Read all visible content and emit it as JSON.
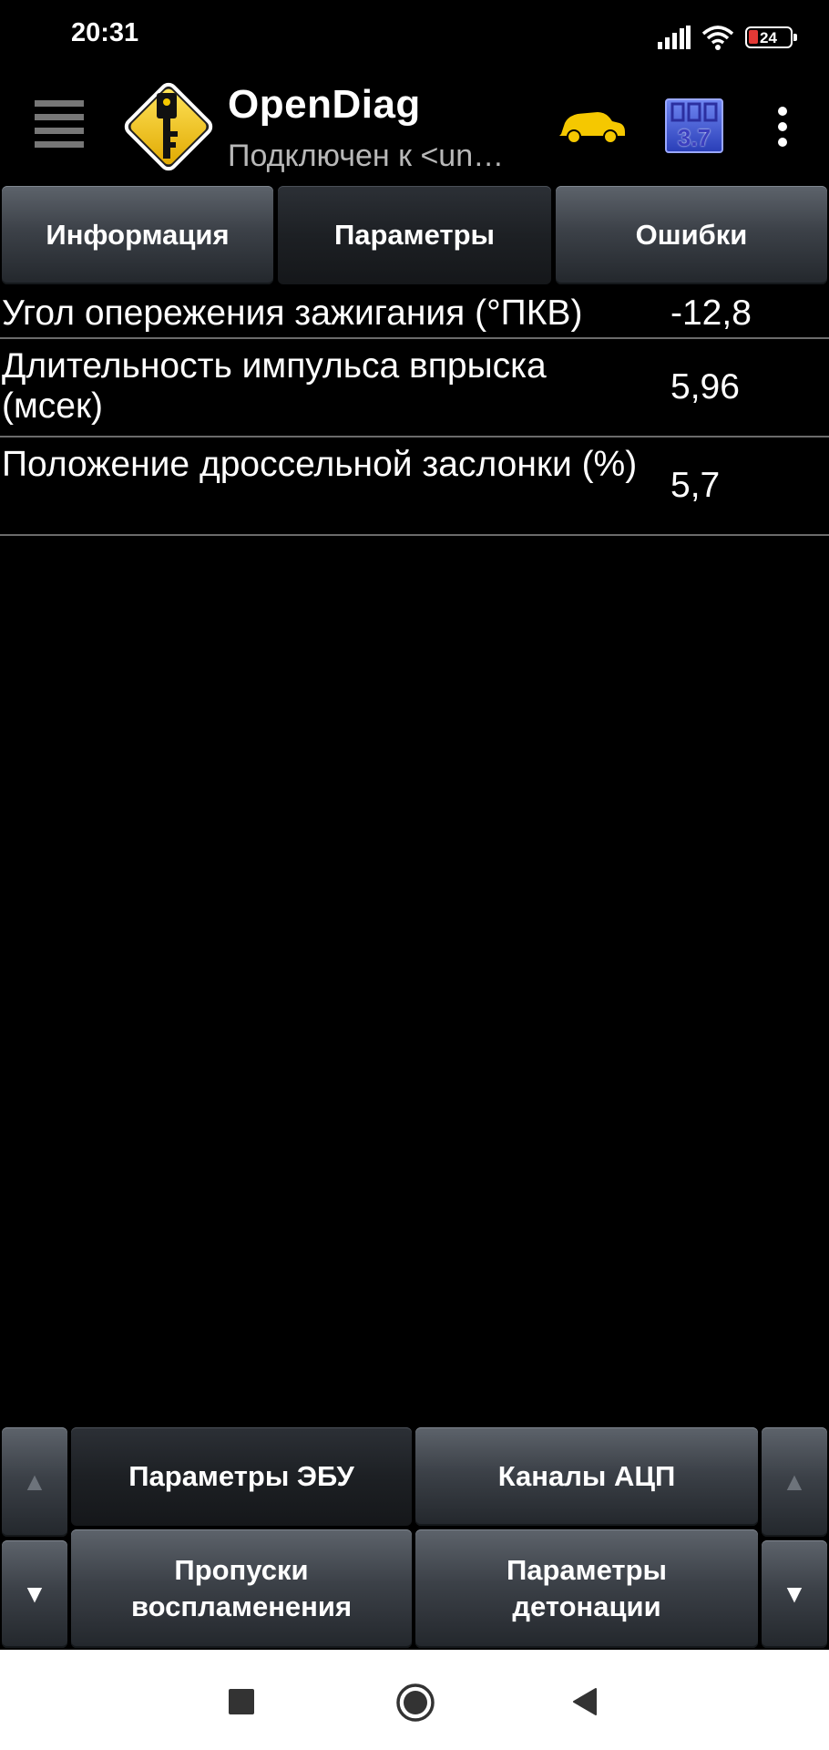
{
  "status_bar": {
    "time": "20:31",
    "battery": "24",
    "icons": [
      "signal-icon",
      "wifi-icon",
      "battery-icon"
    ]
  },
  "app_bar": {
    "title": "OpenDiag",
    "subtitle": "Подключен к <un…",
    "icons": [
      "menu-icon",
      "app-logo-key-icon",
      "car-icon",
      "ecu-icon",
      "overflow-menu-icon"
    ],
    "ecu_icon_text": "3.7"
  },
  "tabs": [
    {
      "label": "Информация",
      "selected": false
    },
    {
      "label": "Параметры",
      "selected": true
    },
    {
      "label": "Ошибки",
      "selected": false
    }
  ],
  "parameters": [
    {
      "label": "Угол опережения зажигания (°ПКВ)",
      "value": "-12,8"
    },
    {
      "label": "Длительность импульса впрыска (мсек)",
      "value": "5,96"
    },
    {
      "label": "Положение дроссельной заслонки (%)",
      "value": "5,7"
    }
  ],
  "bottom_panel": {
    "buttons": [
      {
        "label": "Параметры ЭБУ",
        "selected": true
      },
      {
        "label": "Каналы АЦП",
        "selected": false
      },
      {
        "label": "Пропуски воспламенения",
        "selected": false
      },
      {
        "label": "Параметры детонации",
        "selected": false
      }
    ],
    "scroll_up_glyph": "▲",
    "scroll_down_glyph": "▼"
  },
  "colors": {
    "background": "#000000",
    "accent_yellow": "#f5c800",
    "button_dark": "#3c4148",
    "divider": "#6b6b6b"
  }
}
